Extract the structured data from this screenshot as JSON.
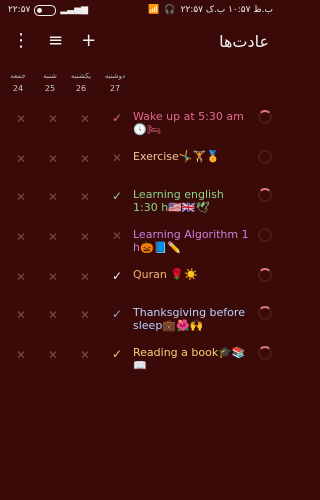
{
  "status": {
    "time_left": "۲۲:۵۷",
    "time_right": "۲۲:۵۷ ب.ظ ۱۰:۵۷ ب.ک"
  },
  "appbar": {
    "title": "عادت‌ها",
    "more_icon": "more-vert-icon",
    "filter_icon": "filter-icon",
    "add_icon": "plus-icon"
  },
  "days": [
    {
      "label": "جمعه",
      "date": "24"
    },
    {
      "label": "شنبه",
      "date": "25"
    },
    {
      "label": "یکشنبه",
      "date": "26"
    },
    {
      "label": "دوشنبه",
      "date": "27"
    }
  ],
  "habits": [
    {
      "name": "Wake up at 5:30 am🕔🛏",
      "color": "#e06b86",
      "checked": true,
      "check_color": "#e06b86",
      "progress": 0.25
    },
    {
      "name": "Exercise🤸‍♂️🏋️🏅",
      "color": "#f0c89c",
      "checked": false,
      "check_color": "#7a4a47",
      "progress": 0
    },
    {
      "name": "Learning english 1:30 h🇺🇸🇬🇧🕊",
      "color": "#8ad38a",
      "checked": true,
      "check_color": "#8ad38a",
      "progress": 0.1
    },
    {
      "name": "Learning Algorithm 1 h🎃📘✏️",
      "color": "#cc7fe0",
      "checked": false,
      "check_color": "#7a4a47",
      "progress": 0
    },
    {
      "name": "Quran 🌹☀️",
      "color": "#f2b36f",
      "checked": true,
      "check_color": "#f2f2f2",
      "progress": 0.2
    },
    {
      "name": "Thanksgiving before sleep💼🌺🙌",
      "color": "#b7d2ff",
      "checked": true,
      "check_color": "#93a8c9",
      "progress": 0.3
    },
    {
      "name": "Reading a book🎓📚📖",
      "color": "#f3d27a",
      "checked": true,
      "check_color": "#f3d27a",
      "progress": 0.2
    }
  ]
}
